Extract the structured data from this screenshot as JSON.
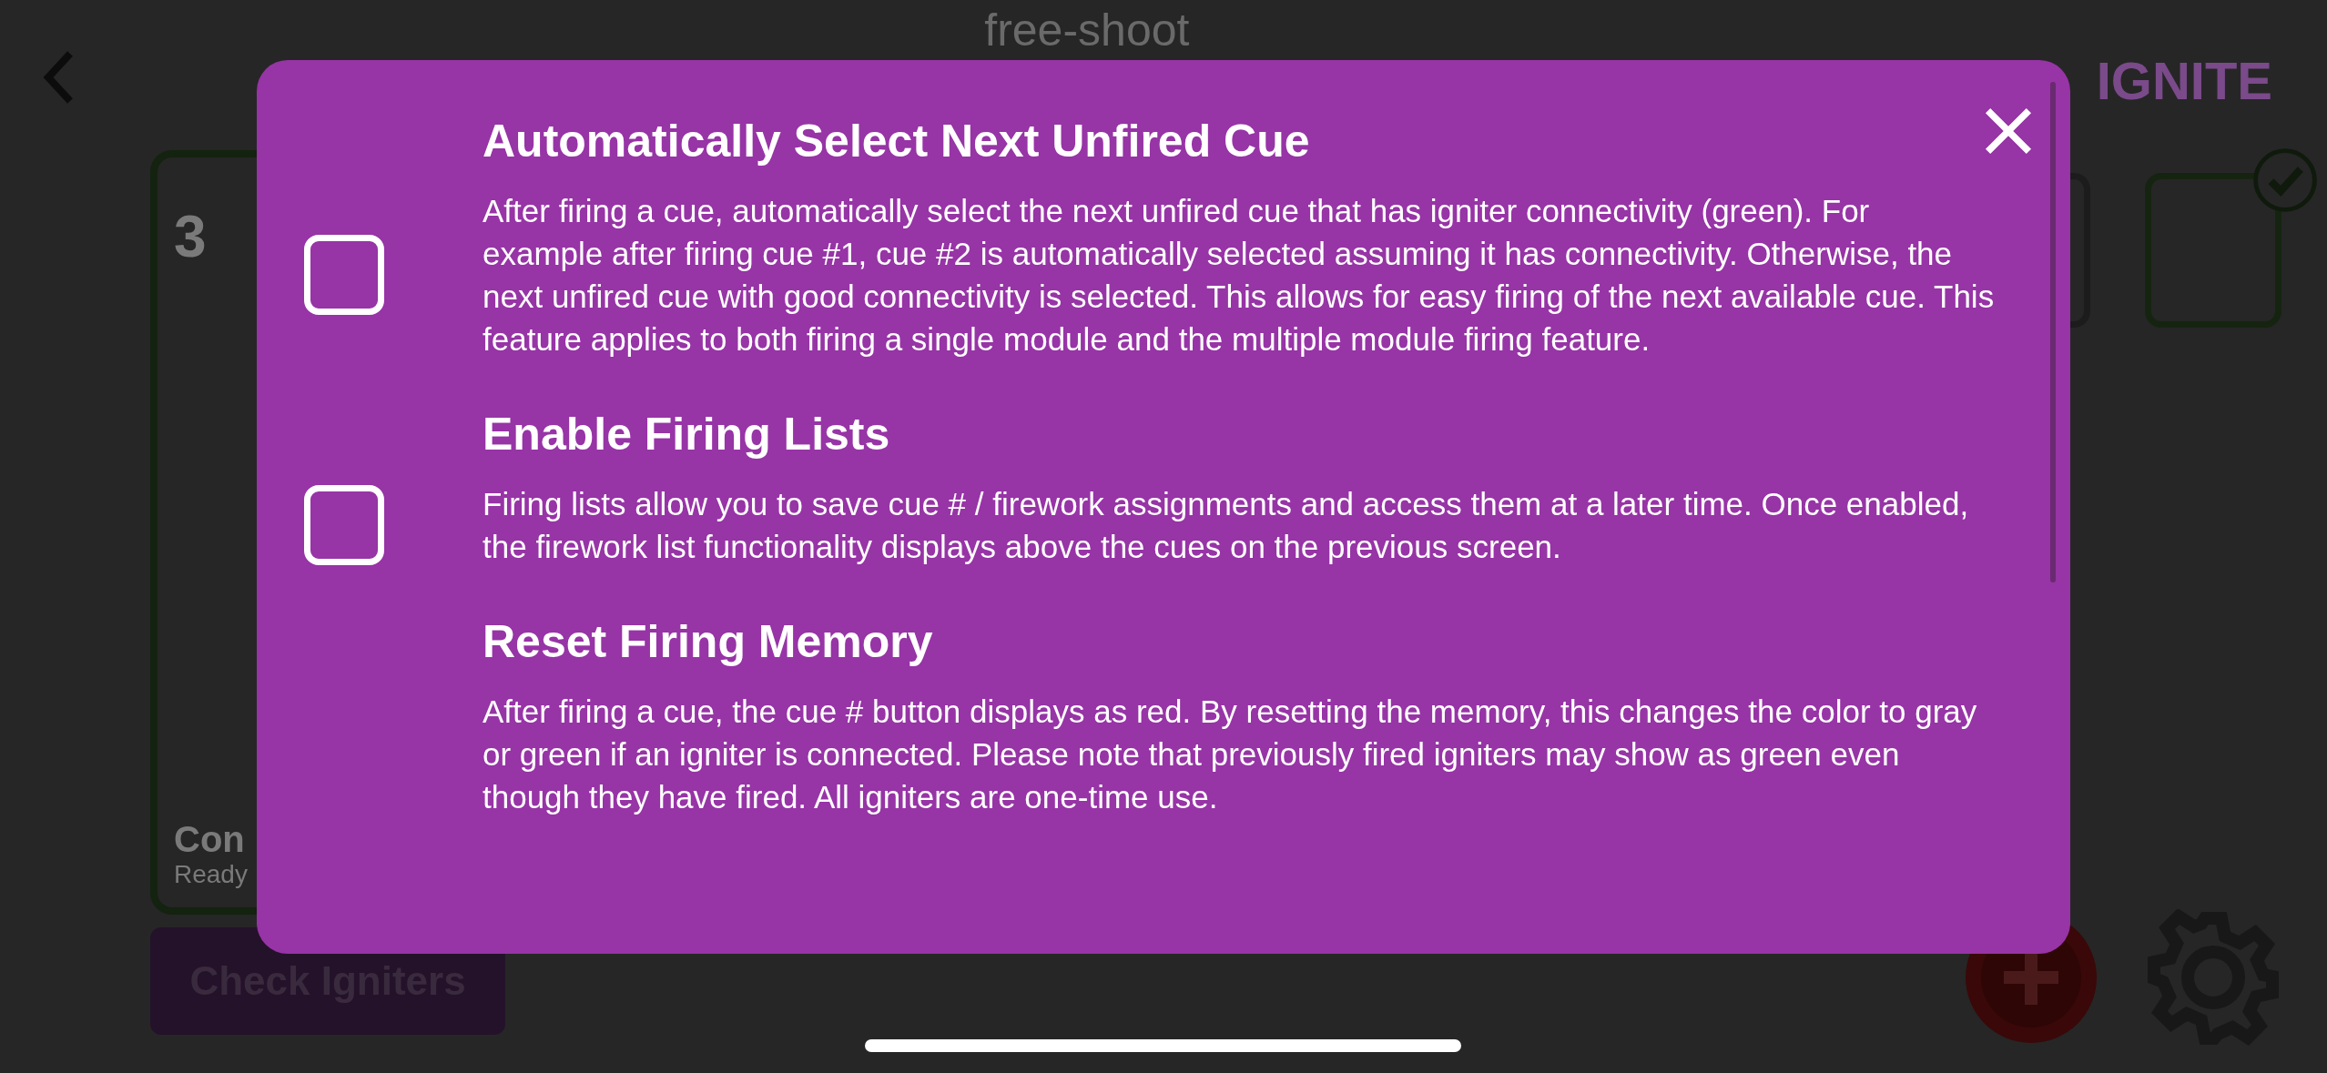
{
  "header": {
    "logo": "free-shoot",
    "brand": "IGNITE"
  },
  "module_card": {
    "number": "3",
    "status": "Con",
    "substatus": "Ready"
  },
  "check_button": "Check Igniters",
  "cue_tiles": [
    {
      "checked": false
    },
    {
      "checked": true
    }
  ],
  "settings_dialog": {
    "options": [
      {
        "kind": "checkbox",
        "title": "Automatically Select Next Unfired Cue",
        "description": "After firing a cue, automatically select the next unfired cue that has igniter connectivity (green). For example after firing cue #1, cue #2 is automatically selected assuming it has connectivity. Otherwise, the next unfired cue with good connectivity is selected. This allows for easy firing of the next available cue. This feature applies to both firing a single module and the multiple module firing feature.",
        "checked": false
      },
      {
        "kind": "checkbox",
        "title": "Enable Firing Lists",
        "description": "Firing lists allow you to save cue # / firework assignments and access them at a later time. Once enabled, the firework list functionality displays above the cues on the previous screen.",
        "checked": false
      },
      {
        "kind": "info",
        "title": "Reset Firing Memory",
        "description": "After firing a cue, the cue # button displays as red. By resetting the memory, this changes the color to gray or green if an igniter is connected. Please note that previously fired igniters may show as green even though they have fired. All igniters are one-time use."
      }
    ]
  }
}
